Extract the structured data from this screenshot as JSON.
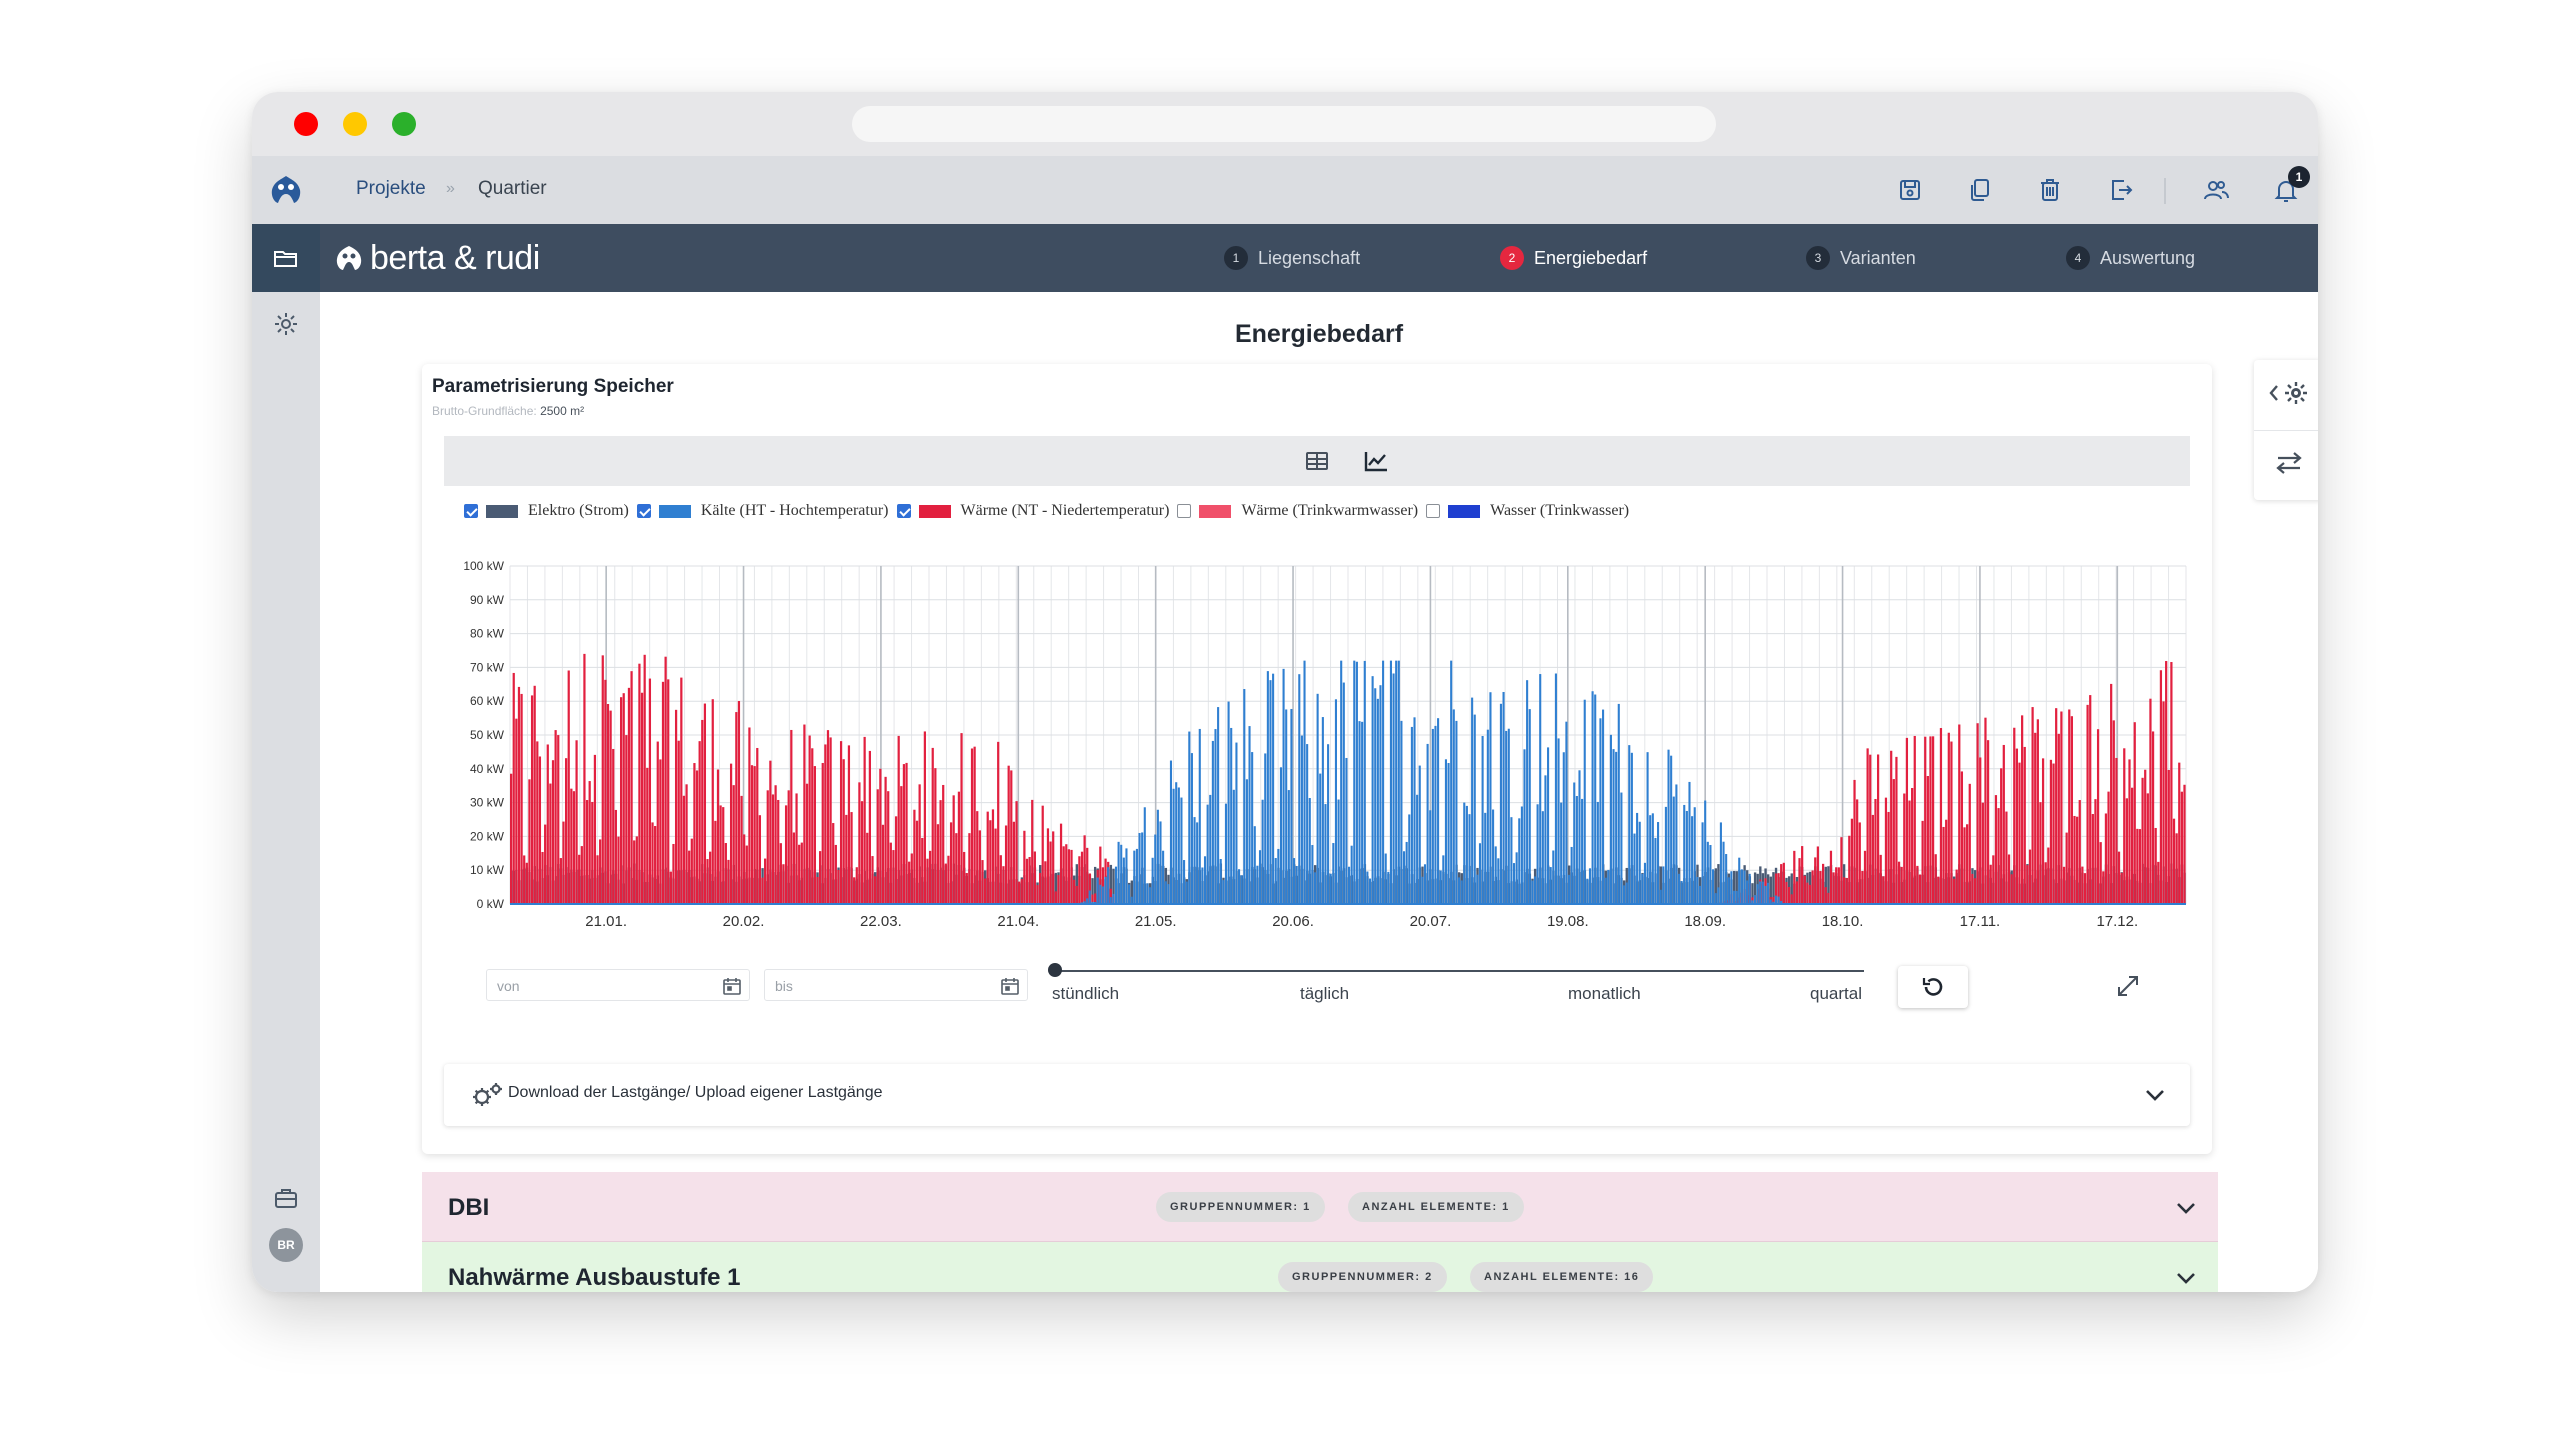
{
  "appbar": {
    "breadcrumb_projects": "Projekte",
    "breadcrumb_separator": "»",
    "breadcrumb_current": "Quartier",
    "notification_count": "1",
    "actions": [
      "save-icon",
      "copy-icon",
      "trash-icon",
      "export-icon",
      "users-icon",
      "bell-icon"
    ]
  },
  "navbar": {
    "brand": "berta & rudi",
    "steps": [
      {
        "num": "1",
        "label": "Liegenschaft"
      },
      {
        "num": "2",
        "label": "Energiebedarf"
      },
      {
        "num": "3",
        "label": "Varianten"
      },
      {
        "num": "4",
        "label": "Auswertung"
      }
    ],
    "active_step": 2
  },
  "sidebar": {
    "avatar": "BR"
  },
  "page": {
    "title": "Energiebedarf"
  },
  "card": {
    "title": "Parametrisierung Speicher",
    "sub_label": "Brutto-Grundfläche:",
    "sub_value": "2500 m²",
    "legend": [
      {
        "checked": true,
        "color": "#4a5b74",
        "label": "Elektro (Strom)"
      },
      {
        "checked": true,
        "color": "#2f7fd1",
        "label": "Kälte (HT - Hochtemperatur)"
      },
      {
        "checked": true,
        "color": "#e2203f",
        "label": "Wärme (NT - Niedertemperatur)"
      },
      {
        "checked": false,
        "color": "#f0506a",
        "label": "Wärme (Trinkwarmwasser)"
      },
      {
        "checked": false,
        "color": "#1f3fd0",
        "label": "Wasser (Trinkwasser)"
      }
    ],
    "from_placeholder": "von",
    "to_placeholder": "bis",
    "resolution": {
      "labels": [
        "stündlich",
        "täglich",
        "monatlich",
        "quartal"
      ],
      "selected": "stündlich"
    },
    "download_text": "Download der Lastgänge/ Upload eigener Lastgänge"
  },
  "chart_data": {
    "type": "bar",
    "ylabel": "",
    "xlabel": "",
    "ylim": [
      0,
      100
    ],
    "yticks": [
      "0 kW",
      "10 kW",
      "20 kW",
      "30 kW",
      "40 kW",
      "50 kW",
      "60 kW",
      "70 kW",
      "80 kW",
      "90 kW",
      "100 kW"
    ],
    "xticks": [
      "21.01.",
      "20.02.",
      "22.03.",
      "21.04.",
      "21.05.",
      "20.06.",
      "20.07.",
      "19.08.",
      "18.09.",
      "18.10.",
      "17.11.",
      "17.12."
    ],
    "grid": true,
    "series": [
      {
        "name": "Elektro (Strom)",
        "color": "#4a5b74",
        "approx_peak_kW": 12
      },
      {
        "name": "Kälte (HT - Hochtemperatur)",
        "color": "#2f7fd1",
        "approx_peak_kW": 72
      },
      {
        "name": "Wärme (NT - Niedertemperatur)",
        "color": "#e2203f",
        "approx_peak_kW": 74
      }
    ]
  },
  "groups": [
    {
      "name": "DBI",
      "chip1": "GRUPPENNUMMER: 1",
      "chip2": "ANZAHL ELEMENTE: 1"
    },
    {
      "name": "Nahwärme Ausbaustufe 1",
      "chip1": "GRUPPENNUMMER: 2",
      "chip2": "ANZAHL ELEMENTE: 16"
    }
  ]
}
